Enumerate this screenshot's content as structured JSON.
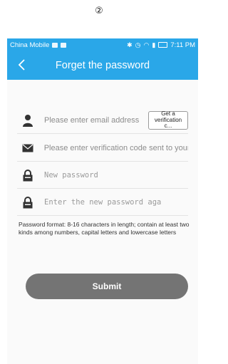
{
  "step_mark": "②",
  "statusbar": {
    "carrier": "China Mobile",
    "time": "7:11 PM"
  },
  "appbar": {
    "title": "Forget the password"
  },
  "form": {
    "email_placeholder": "Please enter email address",
    "get_code_label": "Get a verification c...",
    "code_placeholder": "Please enter verification code sent to your",
    "new_password_placeholder": "New password",
    "confirm_password_placeholder": "Enter the new password aga",
    "password_hint": "Password format: 8-16 characters in length; contain at least two kinds among numbers, capital letters and lowercase letters",
    "submit_label": "Submit"
  },
  "colors": {
    "accent": "#2aa7e8",
    "submit_bg": "#747474"
  },
  "icons": [
    "back-arrow-icon",
    "user-icon",
    "envelope-icon",
    "lock-icon"
  ]
}
